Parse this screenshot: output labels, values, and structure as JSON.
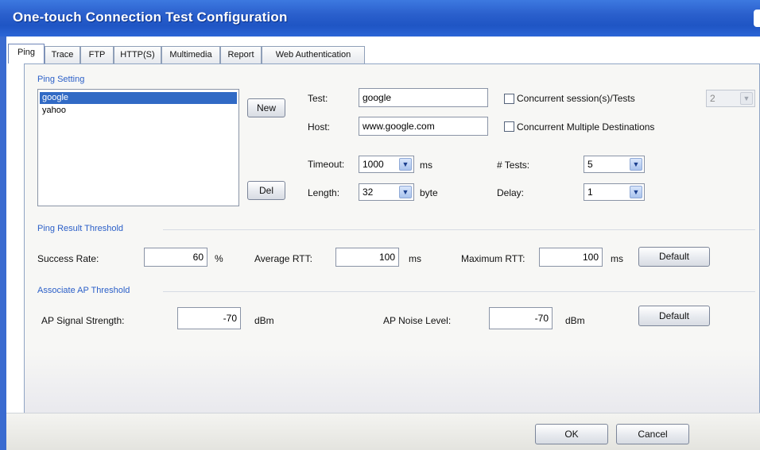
{
  "window": {
    "title": "One-touch Connection Test Configuration"
  },
  "tabs": [
    {
      "label": "Ping"
    },
    {
      "label": "Trace"
    },
    {
      "label": "FTP"
    },
    {
      "label": "HTTP(S)"
    },
    {
      "label": "Multimedia"
    },
    {
      "label": "Report"
    },
    {
      "label": "Web Authentication"
    }
  ],
  "ping_setting": {
    "legend": "Ping Setting",
    "items": [
      {
        "label": "google",
        "selected": true
      },
      {
        "label": "yahoo",
        "selected": false
      }
    ],
    "new_button": "New",
    "del_button": "Del",
    "test_label": "Test:",
    "test_value": "google",
    "host_label": "Host:",
    "host_value": "www.google.com",
    "concurrent_sessions_label": "Concurrent session(s)/Tests",
    "concurrent_sessions_value": "2",
    "concurrent_destinations_label": "Concurrent Multiple Destinations",
    "timeout_label": "Timeout:",
    "timeout_value": "1000",
    "timeout_unit": "ms",
    "length_label": "Length:",
    "length_value": "32",
    "length_unit": "byte",
    "tests_label": "# Tests:",
    "tests_value": "5",
    "delay_label": "Delay:",
    "delay_value": "1"
  },
  "ping_threshold": {
    "legend": "Ping Result Threshold",
    "success_label": "Success Rate:",
    "success_value": "60",
    "success_unit": "%",
    "avg_label": "Average RTT:",
    "avg_value": "100",
    "avg_unit": "ms",
    "max_label": "Maximum RTT:",
    "max_value": "100",
    "max_unit": "ms",
    "default_button": "Default"
  },
  "ap_threshold": {
    "legend": "Associate AP Threshold",
    "signal_label": "AP Signal Strength:",
    "signal_value": "-70",
    "signal_unit": "dBm",
    "noise_label": "AP Noise Level:",
    "noise_value": "-70",
    "noise_unit": "dBm",
    "default_button": "Default"
  },
  "footer": {
    "ok_button": "OK",
    "cancel_button": "Cancel"
  },
  "icons": {
    "dropdown": "chevron-down-icon"
  },
  "colors": {
    "titlebar": "#2a5fcc",
    "legend": "#2b5fc8",
    "selection": "#316ac5"
  }
}
